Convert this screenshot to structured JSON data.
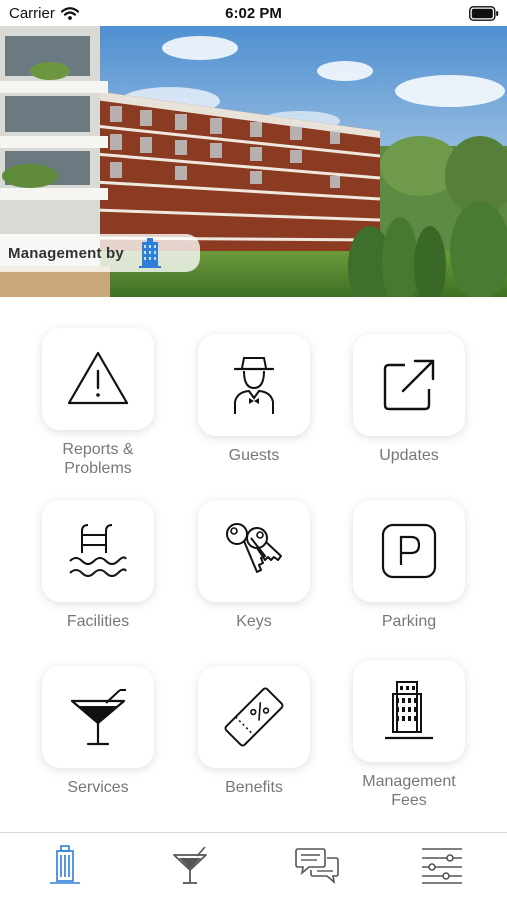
{
  "status_bar": {
    "carrier": "Carrier",
    "time": "6:02 PM"
  },
  "hero": {
    "management_label": "Management by",
    "logo_icon": "building-logo-icon"
  },
  "tiles": [
    {
      "label": "Reports & Problems",
      "icon": "warning-icon"
    },
    {
      "label": "Guests",
      "icon": "bellhop-icon"
    },
    {
      "label": "Updates",
      "icon": "external-link-icon"
    },
    {
      "label": "Facilities",
      "icon": "pool-ladder-icon"
    },
    {
      "label": "Keys",
      "icon": "keys-icon"
    },
    {
      "label": "Parking",
      "icon": "parking-icon"
    },
    {
      "label": "Services",
      "icon": "cocktail-icon"
    },
    {
      "label": "Benefits",
      "icon": "coupon-icon"
    },
    {
      "label": "Management Fees",
      "icon": "building-icon"
    }
  ],
  "tab_bar": {
    "tabs": [
      {
        "icon": "building-icon",
        "active": true
      },
      {
        "icon": "cocktail-icon",
        "active": false
      },
      {
        "icon": "chat-icon",
        "active": false
      },
      {
        "icon": "settings-sliders-icon",
        "active": false
      }
    ]
  },
  "colors": {
    "accent": "#2f7fd9",
    "icon_stroke": "#111111",
    "label": "#777777",
    "tab_inactive": "#555555"
  }
}
